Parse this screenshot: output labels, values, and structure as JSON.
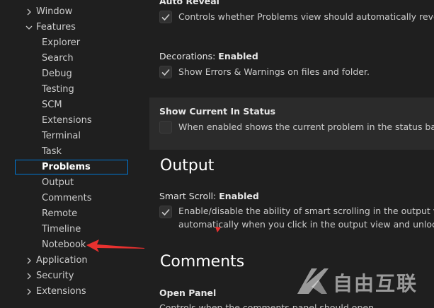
{
  "tree": {
    "items": [
      {
        "label": "Window",
        "expanded": false
      },
      {
        "label": "Features",
        "expanded": true
      },
      {
        "label": "Explorer"
      },
      {
        "label": "Search"
      },
      {
        "label": "Debug"
      },
      {
        "label": "Testing"
      },
      {
        "label": "SCM"
      },
      {
        "label": "Extensions"
      },
      {
        "label": "Terminal"
      },
      {
        "label": "Task"
      },
      {
        "label": "Problems",
        "selected": true
      },
      {
        "label": "Output"
      },
      {
        "label": "Comments"
      },
      {
        "label": "Remote"
      },
      {
        "label": "Timeline"
      },
      {
        "label": "Notebook"
      },
      {
        "label": "Application",
        "expanded": false
      },
      {
        "label": "Security",
        "expanded": false
      },
      {
        "label": "Extensions",
        "expanded": false
      }
    ]
  },
  "editor": {
    "auto_reveal": {
      "title": "Auto Reveal",
      "checked": true,
      "description": "Controls whether Problems view should automatically reveal files when opening them."
    },
    "decorations": {
      "category": "Decorations: ",
      "name": "Enabled",
      "checked": true,
      "description": "Show Errors & Warnings on files and folder."
    },
    "show_current": {
      "title": "Show Current In Status",
      "checked": false,
      "description": "When enabled shows the current problem in the status bar."
    },
    "output_section": "Output",
    "smart_scroll": {
      "category": "Smart Scroll: ",
      "name": "Enabled",
      "checked": true,
      "description_line1": "Enable/disable the ability of smart scrolling in the output view. Smart scrolling allows you to lock scrolling",
      "description_line2": "automatically when you click in the output view and unlocks when you click in the last line."
    },
    "comments_section": "Comments",
    "open_panel": {
      "title": "Open Panel",
      "description": "Controls when the comments panel should open."
    }
  },
  "watermark": {
    "text": "自由互联"
  },
  "colors": {
    "background": "#1f1f1f",
    "focused_row": "#2b2b2b",
    "selection_border": "#0078d4",
    "annotation_red": "#e8312f"
  }
}
